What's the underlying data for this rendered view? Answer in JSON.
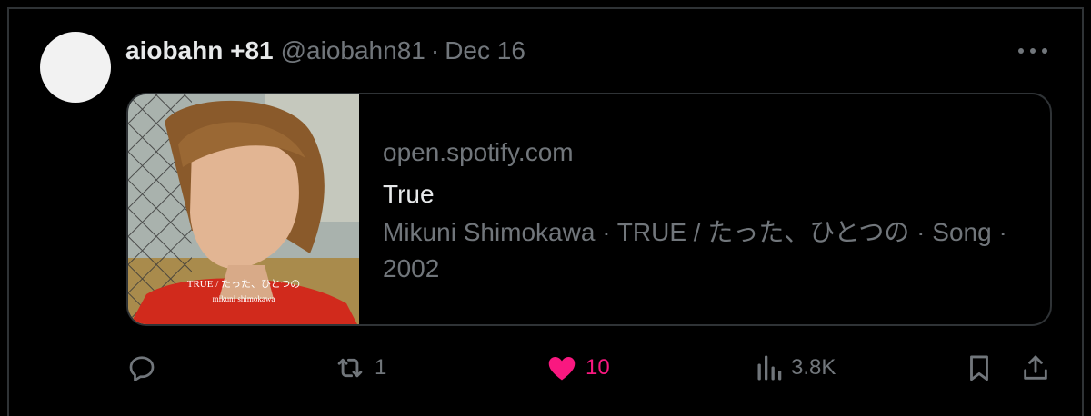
{
  "tweet": {
    "display_name": "aiobahn +81",
    "handle": "@aiobahn81",
    "separator": "·",
    "date": "Dec 16"
  },
  "card": {
    "domain": "open.spotify.com",
    "title": "True",
    "description": "Mikuni Shimokawa · TRUE / たった、ひとつの · Song · 2002",
    "thumbnail": {
      "cover_title": "TRUE / たった、ひとつの",
      "cover_artist": "mikuni shimokawa"
    }
  },
  "actions": {
    "reply_count": "",
    "retweet_count": "1",
    "like_count": "10",
    "views_count": "3.8K"
  },
  "colors": {
    "background": "#000000",
    "text_primary": "#e7e9ea",
    "text_secondary": "#71767b",
    "border": "#2f3336",
    "like_active": "#f91880"
  },
  "icons": [
    "more-icon",
    "reply-icon",
    "retweet-icon",
    "like-icon",
    "views-icon",
    "bookmark-icon",
    "share-icon"
  ]
}
